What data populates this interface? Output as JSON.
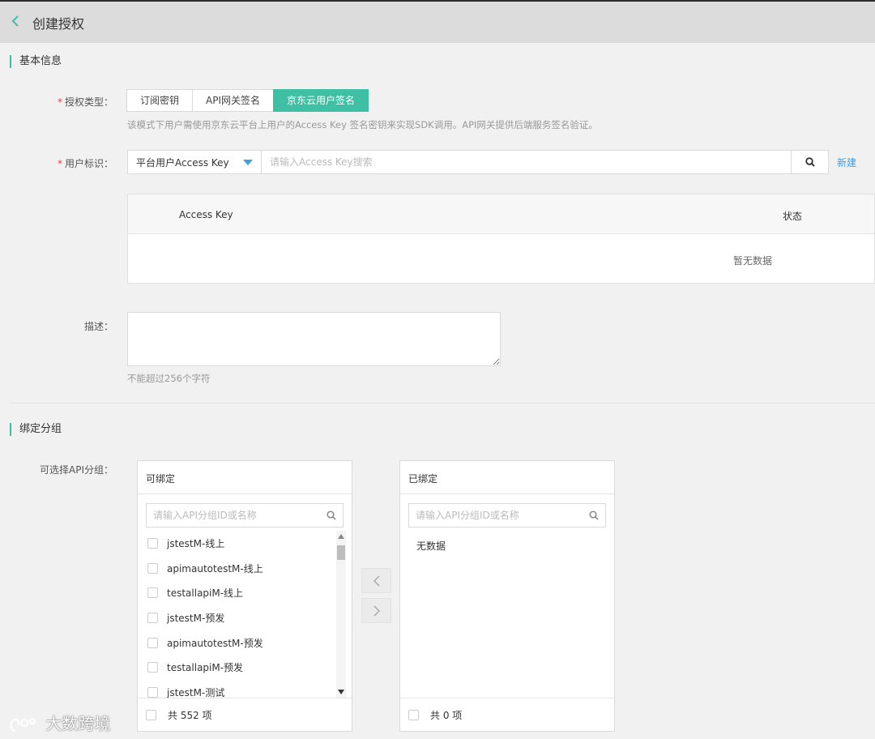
{
  "header": {
    "back_icon": "chevron-left-icon",
    "title": "创建授权"
  },
  "basic": {
    "section_title": "基本信息",
    "auth_type": {
      "label": "授权类型：",
      "options": [
        "订阅密钥",
        "API网关签名",
        "京东云用户签名"
      ],
      "selected": "京东云用户签名",
      "hint": "该模式下用户需使用京东云平台上用户的Access Key 签名密钥来实现SDK调用。API网关提供后端服务签名验证。"
    },
    "user_id": {
      "label": "用户标识：",
      "select_value": "平台用户Access Key",
      "search_placeholder": "请输入Access Key搜索",
      "search_icon": "search-icon",
      "new_link": "新建"
    },
    "table": {
      "columns": [
        "Access Key",
        "状态"
      ],
      "empty_text": "暂无数据"
    },
    "desc": {
      "label": "描述：",
      "value": "",
      "hint": "不能超过256个字符"
    }
  },
  "bind": {
    "section_title": "绑定分组",
    "label": "可选择API分组：",
    "available": {
      "title": "可绑定",
      "placeholder": "请输入API分组ID或名称",
      "items": [
        "jstestM-线上",
        "apimautotestM-线上",
        "testallapiM-线上",
        "jstestM-预发",
        "apimautotestM-预发",
        "testallapiM-预发",
        "jstestM-测试"
      ],
      "footer": "共 552 项"
    },
    "bound": {
      "title": "已绑定",
      "placeholder": "请输入API分组ID或名称",
      "empty_text": "无数据",
      "footer": "共 0 项"
    },
    "move_left_icon": "chevron-left-icon",
    "move_right_icon": "chevron-right-icon"
  },
  "watermark": "大数跨境",
  "colors": {
    "accent": "#3fbfa4",
    "link": "#3aa0e8",
    "required": "#e2423f"
  }
}
